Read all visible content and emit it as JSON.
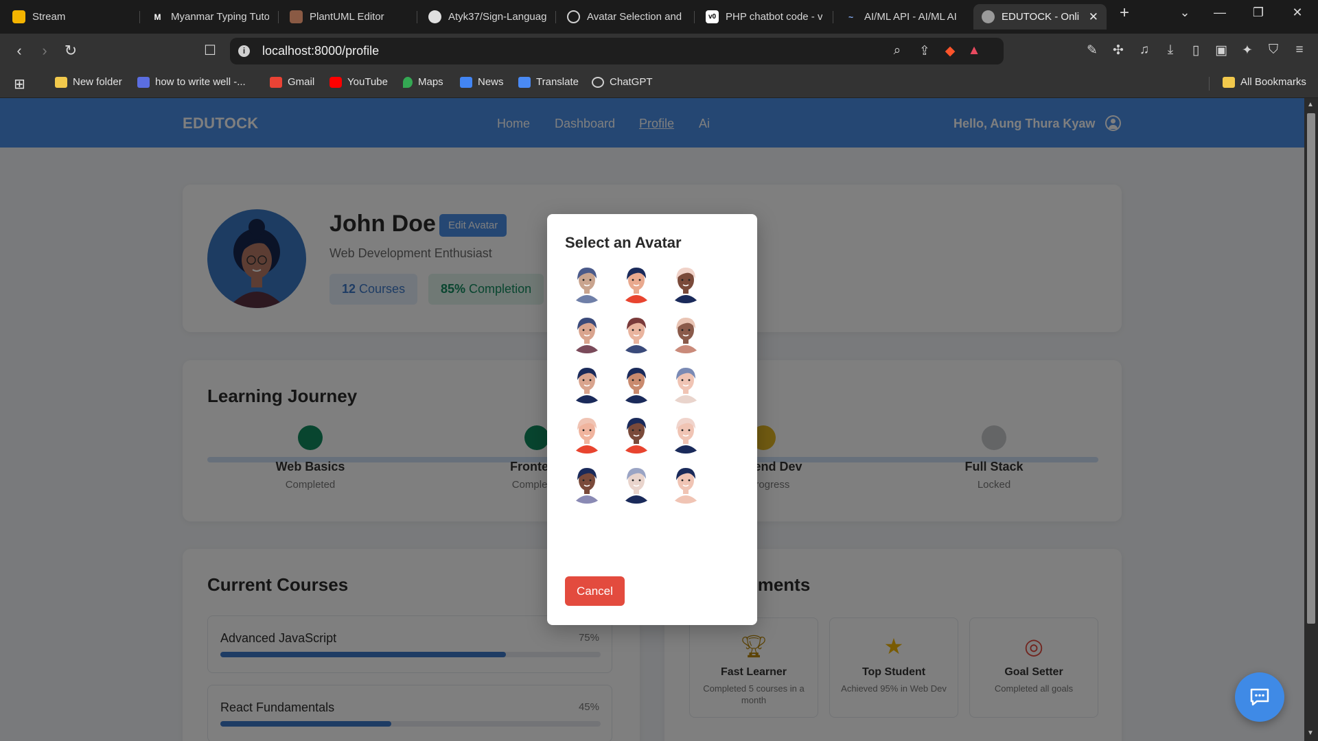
{
  "browser": {
    "tabs": [
      {
        "title": "Stream",
        "favicon_color": "#f4b400"
      },
      {
        "title": "Myanmar Typing Tuto",
        "favicon_color": "#222222"
      },
      {
        "title": "PlantUML Editor",
        "favicon_color": "#8a5a44"
      },
      {
        "title": "Atyk37/Sign-Languag",
        "favicon_color": "#222222"
      },
      {
        "title": "Avatar Selection and",
        "favicon_color": "#555555"
      },
      {
        "title": "PHP chatbot code - v",
        "favicon_color": "#ffffff"
      },
      {
        "title": "AI/ML API - AI/ML AI",
        "favicon_color": "#2a2a7a"
      },
      {
        "title": "EDUTOCK - Onli",
        "favicon_color": "#9a9a9a"
      }
    ],
    "url": "localhost:8000/profile",
    "bookmarks": [
      {
        "label": "New folder",
        "icon": "folder-icon"
      },
      {
        "label": "how to write well -...",
        "icon": "bookmark-site-icon"
      },
      {
        "label": "Gmail",
        "icon": "gmail-icon"
      },
      {
        "label": "YouTube",
        "icon": "youtube-icon"
      },
      {
        "label": "Maps",
        "icon": "maps-icon"
      },
      {
        "label": "News",
        "icon": "news-icon"
      },
      {
        "label": "Translate",
        "icon": "translate-icon"
      },
      {
        "label": "ChatGPT",
        "icon": "chatgpt-icon"
      }
    ],
    "all_bookmarks": "All Bookmarks"
  },
  "nav": {
    "brand": "EDUTOCK",
    "links": [
      "Home",
      "Dashboard",
      "Profile",
      "Ai"
    ],
    "active_link": "Profile",
    "greeting": "Hello, Aung Thura Kyaw"
  },
  "profile": {
    "name": "John Doe",
    "edit_avatar": "Edit Avatar",
    "subtitle": "Web Development Enthusiast",
    "courses_count": "12",
    "courses_label": "Courses",
    "completion_value": "85%",
    "completion_label": "Completion"
  },
  "journey": {
    "title": "Learning Journey",
    "steps": [
      {
        "title": "Web Basics",
        "status": "Completed",
        "color": "#118a5e"
      },
      {
        "title": "Frontend",
        "status": "Completed",
        "color": "#118a5e"
      },
      {
        "title": "Backend Dev",
        "status": "In Progress",
        "color": "#e3b623"
      },
      {
        "title": "Full Stack",
        "status": "Locked",
        "color": "#c8cacd"
      }
    ]
  },
  "courses": {
    "title": "Current Courses",
    "items": [
      {
        "name": "Advanced JavaScript",
        "progress_label": "75%",
        "progress": 0.75
      },
      {
        "name": "React Fundamentals",
        "progress_label": "45%",
        "progress": 0.45
      }
    ]
  },
  "achievements": {
    "title": "Achievements",
    "items": [
      {
        "title": "Fast Learner",
        "desc": "Completed 5 courses in a month",
        "icon": "trophy-icon"
      },
      {
        "title": "Top Student",
        "desc": "Achieved 95% in Web Dev",
        "icon": "star-icon"
      },
      {
        "title": "Goal Setter",
        "desc": "Completed all goals",
        "icon": "target-icon"
      }
    ]
  },
  "modal": {
    "title": "Select an Avatar",
    "cancel": "Cancel",
    "avatars": [
      {
        "hair": "#4a5a8a",
        "skin": "#c9a48e",
        "shirt": "#6f7fa8"
      },
      {
        "hair": "#1a2a5a",
        "skin": "#e9a98e",
        "shirt": "#e8442f"
      },
      {
        "hair": "#f0d2c8",
        "skin": "#7a4a3a",
        "shirt": "#1a2a5a"
      },
      {
        "hair": "#3a4a7a",
        "skin": "#d9a48e",
        "shirt": "#7a4a5a"
      },
      {
        "hair": "#7a3a3a",
        "skin": "#e9b49e",
        "shirt": "#3a4a7a"
      },
      {
        "hair": "#e9c4b4",
        "skin": "#8a5a4a",
        "shirt": "#c98a7a"
      },
      {
        "hair": "#1a2a5a",
        "skin": "#d9a48e",
        "shirt": "#1a2a5a"
      },
      {
        "hair": "#1a2a5a",
        "skin": "#c98a6e",
        "shirt": "#1a2a5a"
      },
      {
        "hair": "#7a8ab4",
        "skin": "#f0c4b4",
        "shirt": "#e9d4cc"
      },
      {
        "hair": "#f0c4b4",
        "skin": "#f0b49e",
        "shirt": "#e8442f"
      },
      {
        "hair": "#1a2a5a",
        "skin": "#7a4a3a",
        "shirt": "#e8442f"
      },
      {
        "hair": "#f0d4cc",
        "skin": "#f0c4b4",
        "shirt": "#1a2a5a"
      },
      {
        "hair": "#1a2a5a",
        "skin": "#7a4a3a",
        "shirt": "#8a8ab4"
      },
      {
        "hair": "#9aa4c4",
        "skin": "#e9d4cc",
        "shirt": "#1a2a5a"
      },
      {
        "hair": "#1a2a5a",
        "skin": "#f0c4b4",
        "shirt": "#f0c4b4"
      }
    ]
  },
  "colors": {
    "primary": "#4a8fe7",
    "danger": "#e34b3e",
    "success": "#118a5e",
    "warning": "#e3b623"
  }
}
